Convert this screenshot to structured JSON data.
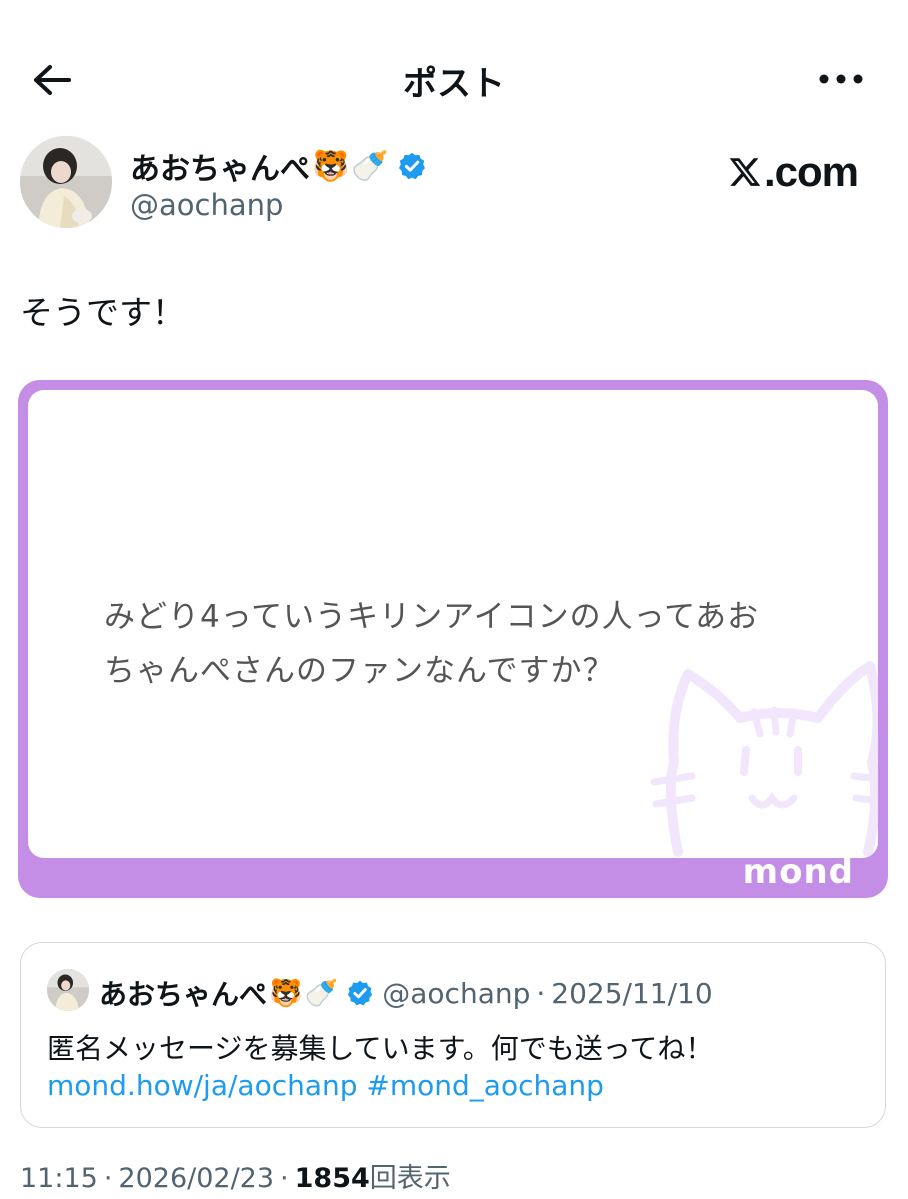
{
  "header": {
    "title": "ポスト",
    "back_icon": "arrow-left-icon",
    "more_icon": "more-horizontal-icon"
  },
  "author": {
    "display_name": "あおちゃんぺ",
    "emoji_1": "🐯",
    "emoji_2": "🍼",
    "handle": "@aochanp",
    "verified": true,
    "verified_color": "#1d9bf0"
  },
  "site_mark": {
    "icon": "x-logo-icon",
    "text": ".com"
  },
  "post": {
    "text": "そうです！"
  },
  "card": {
    "question_line_1": "みどり4っていうキリンアイコンの人ってあお",
    "question_line_2": "ちゃんぺさんのファンなんですか？",
    "logo_text": "mond",
    "border_color": "#c48ee6"
  },
  "quoted_post": {
    "display_name": "あおちゃんぺ",
    "emoji_1": "🐯",
    "emoji_2": "🍼",
    "handle": "@aochanp",
    "separator": "·",
    "date": "2025/11/10",
    "text": "匿名メッセージを募集しています。何でも送ってね！",
    "link": "mond.how/ja/aochanp",
    "hashtag": "#mond_aochanp"
  },
  "meta": {
    "time": "11:15",
    "separator": "·",
    "date": "2026/02/23",
    "views": "1854",
    "views_label": "回表示"
  }
}
